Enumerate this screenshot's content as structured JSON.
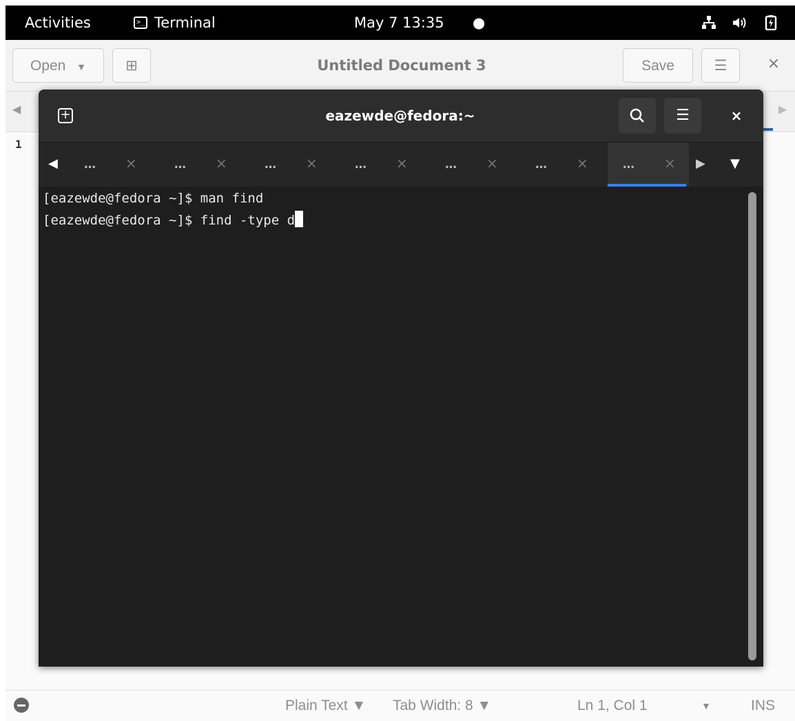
{
  "topbar": {
    "activities": "Activities",
    "app_name": "Terminal",
    "app_icon_glyph": ">_",
    "clock": "May 7  13:35",
    "indicator": "●"
  },
  "gedit": {
    "open_label": "Open",
    "dropdown_glyph": "▼",
    "new_tab_glyph": "⊞",
    "title": "Untitled Document 3",
    "save_label": "Save",
    "menu_glyph": "☰",
    "close_glyph": "×",
    "line_number": "1",
    "status": {
      "language": "Plain Text ▼",
      "tab_width": "Tab Width: 8 ▼",
      "position": "Ln 1, Col 1",
      "position_dropdown": "▼",
      "mode": "INS"
    }
  },
  "terminal": {
    "title": "eazewde@fedora:~",
    "new_tab_glyph": "+",
    "search_glyph": "🔍︎",
    "menu_glyph": "☰",
    "close_glyph": "×",
    "tabs": [
      {
        "label": "…",
        "close": "×"
      },
      {
        "label": "…",
        "close": "×"
      },
      {
        "label": "…",
        "close": "×"
      },
      {
        "label": "…",
        "close": "×"
      },
      {
        "label": "…",
        "close": "×"
      },
      {
        "label": "…",
        "close": "×"
      },
      {
        "label": "…",
        "close": "×"
      }
    ],
    "tab_prev_glyph": "◀",
    "tab_next_glyph": "▶",
    "tab_menu_glyph": "▼",
    "lines": [
      "[eazewde@fedora ~]$ man find",
      "[eazewde@fedora ~]$ find -type d"
    ]
  },
  "icons": {
    "network": "network-icon",
    "volume": "volume-icon",
    "battery": "battery-icon"
  }
}
